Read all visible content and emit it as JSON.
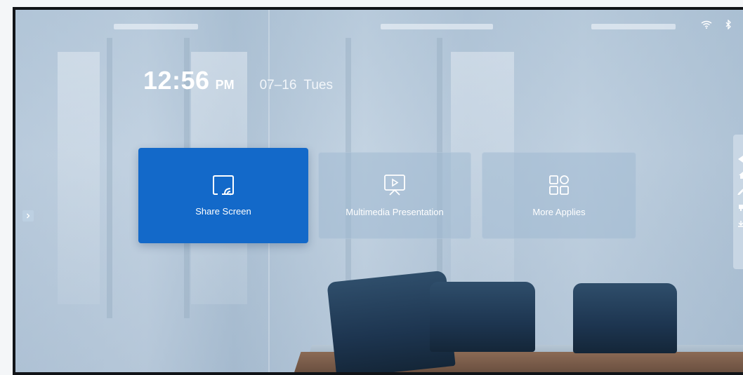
{
  "status_bar": {
    "icons": [
      "wifi-icon",
      "bluetooth-icon"
    ]
  },
  "clock": {
    "time": "12:56",
    "ampm": "PM",
    "date": "07–16",
    "weekday": "Tues"
  },
  "tiles": [
    {
      "label": "Share Screen",
      "icon": "screen-cast-icon",
      "color": "#1369c9"
    },
    {
      "label": "Multimedia Presentation",
      "icon": "presentation-icon"
    },
    {
      "label": "More Applies",
      "icon": "apps-grid-icon"
    }
  ],
  "side_toolbar": {
    "icons": [
      "back-icon",
      "home-icon",
      "pen-icon",
      "screen-icon",
      "download-icon"
    ]
  },
  "left_toggle": {
    "icon": "chevron-right-icon"
  }
}
